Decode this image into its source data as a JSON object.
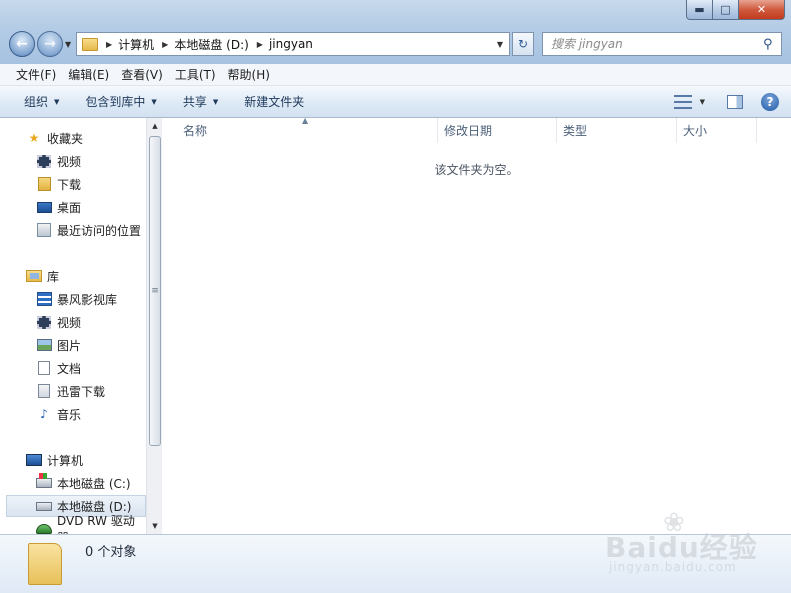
{
  "window": {
    "controls": {
      "minimize": "▬",
      "maximize": "□",
      "close": "✕"
    }
  },
  "navigation": {
    "back_icon": "←",
    "forward_icon": "→",
    "address_crumbs": [
      "计算机",
      "本地磁盘 (D:)",
      "jingyan"
    ],
    "search_placeholder": "搜索 jingyan"
  },
  "menubar": {
    "items": [
      "文件(F)",
      "编辑(E)",
      "查看(V)",
      "工具(T)",
      "帮助(H)"
    ]
  },
  "commandbar": {
    "organize": "组织",
    "include_in_library": "包含到库中",
    "share": "共享",
    "new_folder": "新建文件夹",
    "help_glyph": "?"
  },
  "sidebar": {
    "favorites": {
      "label": "收藏夹",
      "items": [
        "视频",
        "下载",
        "桌面",
        "最近访问的位置"
      ]
    },
    "libraries": {
      "label": "库",
      "items": [
        "暴风影视库",
        "视频",
        "图片",
        "文档",
        "迅雷下载",
        "音乐"
      ]
    },
    "computer": {
      "label": "计算机",
      "items": [
        "本地磁盘 (C:)",
        "本地磁盘 (D:)",
        "DVD RW 驱动器"
      ]
    }
  },
  "columns": [
    "名称",
    "修改日期",
    "类型",
    "大小"
  ],
  "content": {
    "empty_message": "该文件夹为空。"
  },
  "status": {
    "object_count": "0 个对象"
  },
  "watermark": {
    "logo_text": "Baidu经验",
    "url": "jingyan.baidu.com"
  }
}
